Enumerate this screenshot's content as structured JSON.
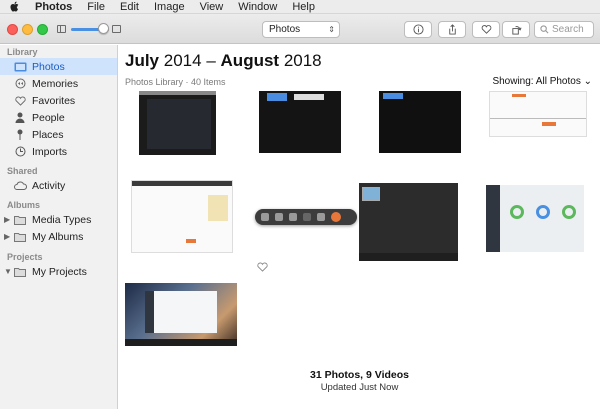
{
  "menubar": {
    "app_name": "Photos",
    "items": [
      "File",
      "Edit",
      "Image",
      "View",
      "Window",
      "Help"
    ]
  },
  "toolbar": {
    "view_popup": "Photos",
    "search_placeholder": "Search",
    "buttons": [
      "info-icon",
      "share-icon",
      "heart-icon",
      "rotate-icon"
    ]
  },
  "sidebar": {
    "library_heading": "Library",
    "library_items": [
      {
        "label": "Photos",
        "icon": "photos-icon",
        "active": true
      },
      {
        "label": "Memories",
        "icon": "memories-icon"
      },
      {
        "label": "Favorites",
        "icon": "heart-icon"
      },
      {
        "label": "People",
        "icon": "person-icon"
      },
      {
        "label": "Places",
        "icon": "pin-icon"
      },
      {
        "label": "Imports",
        "icon": "clock-icon"
      }
    ],
    "shared_heading": "Shared",
    "shared_items": [
      {
        "label": "Activity",
        "icon": "cloud-icon"
      }
    ],
    "albums_heading": "Albums",
    "album_items": [
      {
        "label": "Media Types",
        "icon": "folder-icon"
      },
      {
        "label": "My Albums",
        "icon": "folder-icon"
      }
    ],
    "projects_heading": "Projects",
    "project_items": [
      {
        "label": "My Projects",
        "icon": "folder-icon"
      }
    ]
  },
  "main": {
    "title_month1": "July",
    "title_year1": "2014",
    "title_dash": "–",
    "title_month2": "August",
    "title_year2": "2018",
    "subtitle": "Photos Library · 40 Items",
    "showing": "Showing: All Photos",
    "footer_count": "31 Photos, 9 Videos",
    "footer_updated": "Updated Just Now"
  },
  "colors": {
    "accent": "#1a5cc4",
    "selection": "#cfe3fc",
    "sidebar_bg": "#f1f1f1"
  }
}
